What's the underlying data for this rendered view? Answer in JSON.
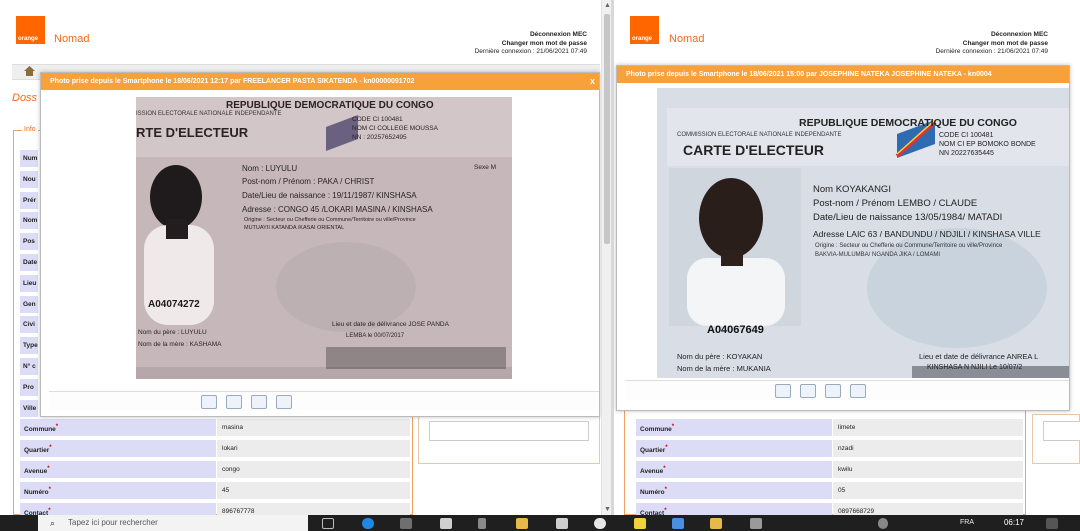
{
  "left": {
    "brand": "Nomad",
    "logo_text": "orange",
    "logout": "Déconnexion MEC",
    "change_password": "Changer mon mot de passe",
    "last_login": "Dernière connexion : 21/06/2021 07:49",
    "page_title": "Doss",
    "legend": "Info",
    "side_labels": [
      "Num",
      "Nou",
      "Prér",
      "Nom",
      "Pos",
      "Date",
      "Lieu",
      "Gen",
      "Civi",
      "Type",
      "N° c",
      "Pro",
      "Ville"
    ],
    "modal": {
      "title": "Photo prise depuis le Smartphone le 18/06/2021 12:17 par FREELANCER PASTA SIKATENDA - kn00000091702",
      "close": "x",
      "card": {
        "header": "REPUBLIQUE DEMOCRATIQUE DU CONGO",
        "commission": "ISSION ELECTORALE NATIONALE INDEPENDANTE",
        "card_title": "RTE D'ELECTEUR",
        "code_ci": "CODE CI 100481",
        "nom_ci": "NOM CI COLLEGE MOUSSA",
        "nn": "NN : 20257652495",
        "nom": "Nom : LUYULU",
        "sexe": "Sexe M",
        "postnom": "Post-nom / Prénom : PAKA / CHRIST",
        "naissance": "Date/Lieu de naissance : 19/11/1987/ KINSHASA",
        "adresse": "Adresse : CONGO 45 /LOKARI MASINA / KINSHASA",
        "origine": "Origine : Secteur ou Chefferie ou Commune/Territoire ou ville/Province",
        "origine_val": "MUTUAYII KATANDA /KASAI ORIENTAL",
        "number": "A04074272",
        "pere": "Nom du père : LUYULU",
        "mere": "Nom de la mère : KASHAMA",
        "delivrance": "Lieu et date de délivrance JOSE PANDA",
        "delivrance_val": "LEMBA le 00/07/2017"
      }
    },
    "rows": [
      {
        "label": "Commune",
        "value": "masina"
      },
      {
        "label": "Quartier",
        "value": "lokari"
      },
      {
        "label": "Avenue",
        "value": "congo"
      },
      {
        "label": "Numéro",
        "value": "45"
      },
      {
        "label": "Contact",
        "value": "896767778"
      }
    ]
  },
  "right": {
    "brand": "Nomad",
    "logo_text": "orange",
    "logout": "Déconnexion MEC",
    "change_password": "Changer mon mot de passe",
    "last_login": "Dernière connexion : 21/06/2021 07:49",
    "modal": {
      "title": "Photo prise depuis le Smartphone le 18/06/2021 15:00 par JOSEPHINE NATEKA JOSEPHINE NATEKA - kn0004",
      "card": {
        "header": "REPUBLIQUE DEMOCRATIQUE DU CONGO",
        "commission": "COMMISSION ELECTORALE NATIONALE INDEPENDANTE",
        "card_title": "CARTE D'ELECTEUR",
        "code_ci": "CODE CI 100481",
        "nom_ci": "NOM CI    EP BOMOKO BONDE",
        "nn": "NN 20227635445",
        "nom": "Nom  KOYAKANGI",
        "postnom": "Post-nom / Prénom  LEMBO / CLAUDE",
        "naissance": "Date/Lieu de naissance  13/05/1984/ MATADI",
        "adresse": "Adresse  LAIC 63 / BANDUNDU / NDJILI / KINSHASA VILLE",
        "origine": "Origine : Secteur ou Chefferie ou Commune/Territoire ou ville/Province",
        "origine_val": "BAKVIA-MULUMBA/ NGANDA JIKA / LOMAMI",
        "number": "A04067649",
        "pere": "Nom du père : KOYAKAN",
        "mere": "Nom de la mère : MUKANIA",
        "delivrance": "Lieu et date de délivrance  ANREA L",
        "delivrance_val": "KINSHASA N NJILI Le 10/07/2"
      }
    },
    "rows": [
      {
        "label": "Commune",
        "value": "limete"
      },
      {
        "label": "Quartier",
        "value": "nzadi"
      },
      {
        "label": "Avenue",
        "value": "kwilu"
      },
      {
        "label": "Numéro",
        "value": "05"
      },
      {
        "label": "Contact",
        "value": "0897668729"
      }
    ]
  },
  "taskbar": {
    "search_placeholder": "Tapez ici pour rechercher",
    "lang": "FRA",
    "clock": "06:17"
  },
  "colors": {
    "orange": "#ff6600",
    "modal_header": "#f7a13a",
    "label_bg": "#dcdcf6"
  }
}
